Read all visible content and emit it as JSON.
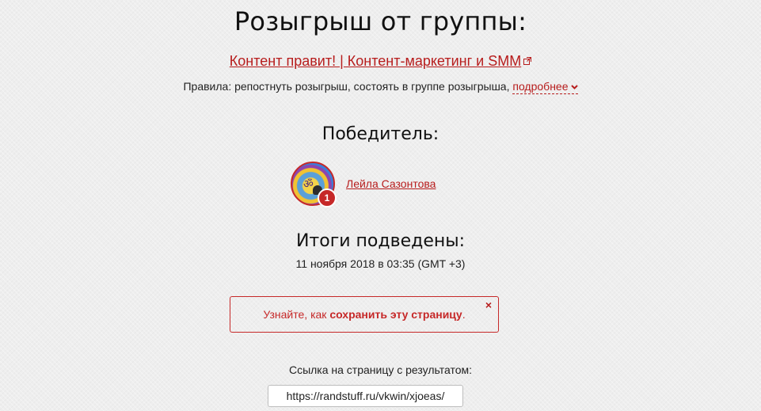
{
  "header": {
    "title": "Розыгрыш от группы:"
  },
  "group": {
    "link_label": "Контент правит! | Контент-маркетинг и SMM",
    "external_icon": "external-link-icon"
  },
  "rules": {
    "text": "Правила: репостнуть розыгрыш, состоять в группе розыгрыша,",
    "more_label": "подробнее",
    "more_icon": "chevron-down-icon"
  },
  "winner": {
    "heading": "Победитель:",
    "name": "Лейла Сазонтова",
    "place_badge": "1"
  },
  "results": {
    "heading": "Итоги подведены:",
    "date": "11 ноября 2018 в 03:35 (GMT +3)"
  },
  "notice": {
    "prefix": "Узнайте, как ",
    "link_label": "сохранить эту страницу",
    "suffix": ".",
    "close_label": "×"
  },
  "result_link": {
    "label": "Ссылка на страницу с результатом:",
    "value": "https://randstuff.ru/vkwin/xjoeas/"
  },
  "colors": {
    "accent": "#b71c1c",
    "background": "#eeeeee",
    "text": "#111111"
  }
}
